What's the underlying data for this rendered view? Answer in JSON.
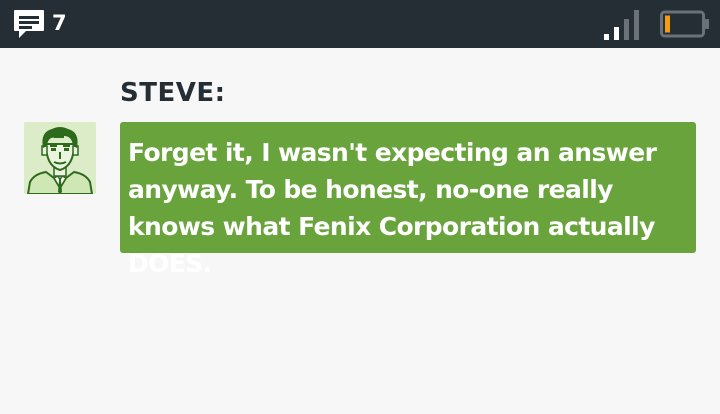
{
  "status_bar": {
    "message_icon": "speech-bubble-icon",
    "message_count": "7",
    "signal_icon": "signal-bars-icon",
    "signal_bars_filled": 2,
    "signal_bars_total": 4,
    "battery_icon": "battery-icon",
    "battery_level": 0.15,
    "colors": {
      "background": "#252d35",
      "battery_fill": "#f39c12",
      "icon": "#ffffff",
      "icon_dim": "#6b7178"
    }
  },
  "dialogue": {
    "speaker": "STEVE:",
    "avatar_icon": "steve-portrait-icon",
    "text": "Forget it, I wasn't expecting an answer anyway. To be honest, no-one really knows what Fenix Corporation actually DOES.",
    "colors": {
      "bubble": "#69a33b",
      "text": "#ffffff",
      "avatar_bg": "#dcecc9",
      "avatar_ink": "#2d6a1c"
    }
  }
}
